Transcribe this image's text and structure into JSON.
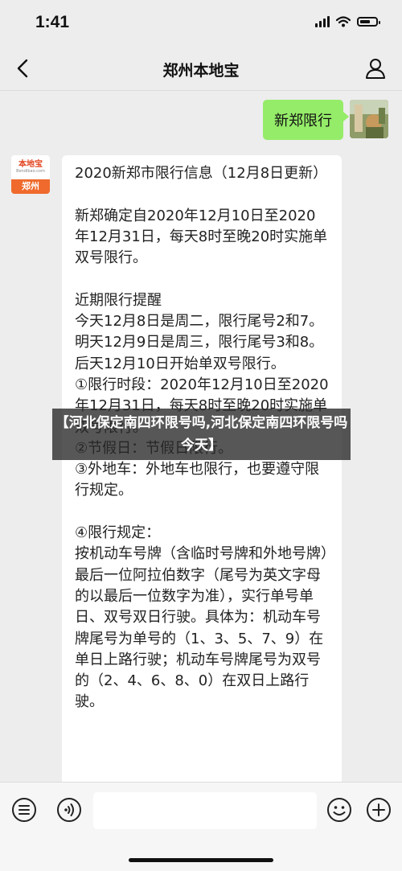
{
  "status_bar": {
    "time": "1:41"
  },
  "nav": {
    "title": "郑州本地宝"
  },
  "outgoing_message": {
    "text": "新郑限行"
  },
  "sender_avatar": {
    "brand": "本地宝",
    "site": "Bendibao.com",
    "city": "郑州"
  },
  "incoming_message": {
    "text": "2020新郑市限行信息（12月8日更新）\n\n新郑确定自2020年12月10日至2020年12月31日，每天8时至晚20时实施单双号限行。\n\n近期限行提醒\n今天12月8日是周二，限行尾号2和7。\n明天12月9日是周三，限行尾号3和8。\n后天12月10日开始单双号限行。\n①限行时段：2020年12月10日至2020年12月31日，每天8时至晚20时实施单双号限行。\n②节假日：节假日限行。\n③外地车：外地车也限行，也要遵守限行规定。\n\n④限行规定：\n按机动车号牌（含临时号牌和外地号牌）最后一位阿拉伯数字（尾号为英文字母的以最后一位数字为准），实行单号单日、双号双日行驶。具体为：机动车号牌尾号为单号的（1、3、5、7、9）在单日上路行驶；机动车号牌尾号为双号的（2、4、6、8、0）在双日上路行驶。"
  },
  "overlay": {
    "title": "【河北保定南四环限号吗,河北保定南四环限号吗今天】"
  }
}
